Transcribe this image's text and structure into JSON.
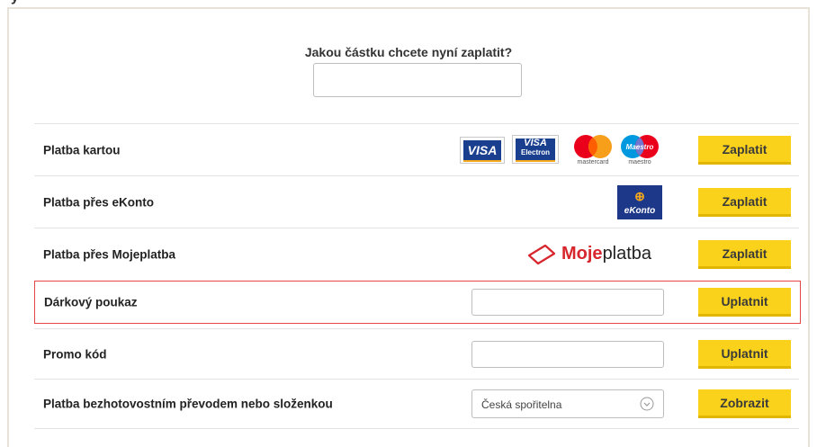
{
  "header": {
    "partial_title": "y"
  },
  "amount": {
    "question": "Jakou částku chcete nyní zaplatit?",
    "value": ""
  },
  "payments": [
    {
      "label": "Platba kartou",
      "button": "Zaplatit",
      "logos": [
        "VISA",
        "VISA",
        "Electron",
        "mastercard",
        "maestro",
        "Maestro"
      ]
    },
    {
      "label": "Platba přes eKonto",
      "button": "Zaplatit",
      "logos": [
        "eKonto"
      ]
    },
    {
      "label": "Platba přes Mojeplatba",
      "button": "Zaplatit",
      "logos": [
        "Moje",
        "platba"
      ]
    },
    {
      "label": "Dárkový poukaz",
      "button": "Uplatnit",
      "value": ""
    },
    {
      "label": "Promo kód",
      "button": "Uplatnit",
      "value": ""
    },
    {
      "label": "Platba bezhotovostním převodem nebo složenkou",
      "button": "Zobrazit",
      "select_value": "Česká spořitelna"
    }
  ],
  "colors": {
    "button_bg": "#fbd21b",
    "highlight_border": "#e64646",
    "visa_blue": "#1a3f8f",
    "ekonto_blue": "#1d3889",
    "mojeplatba_red": "#d7262d"
  },
  "icons": [
    "chevron-down-icon"
  ]
}
